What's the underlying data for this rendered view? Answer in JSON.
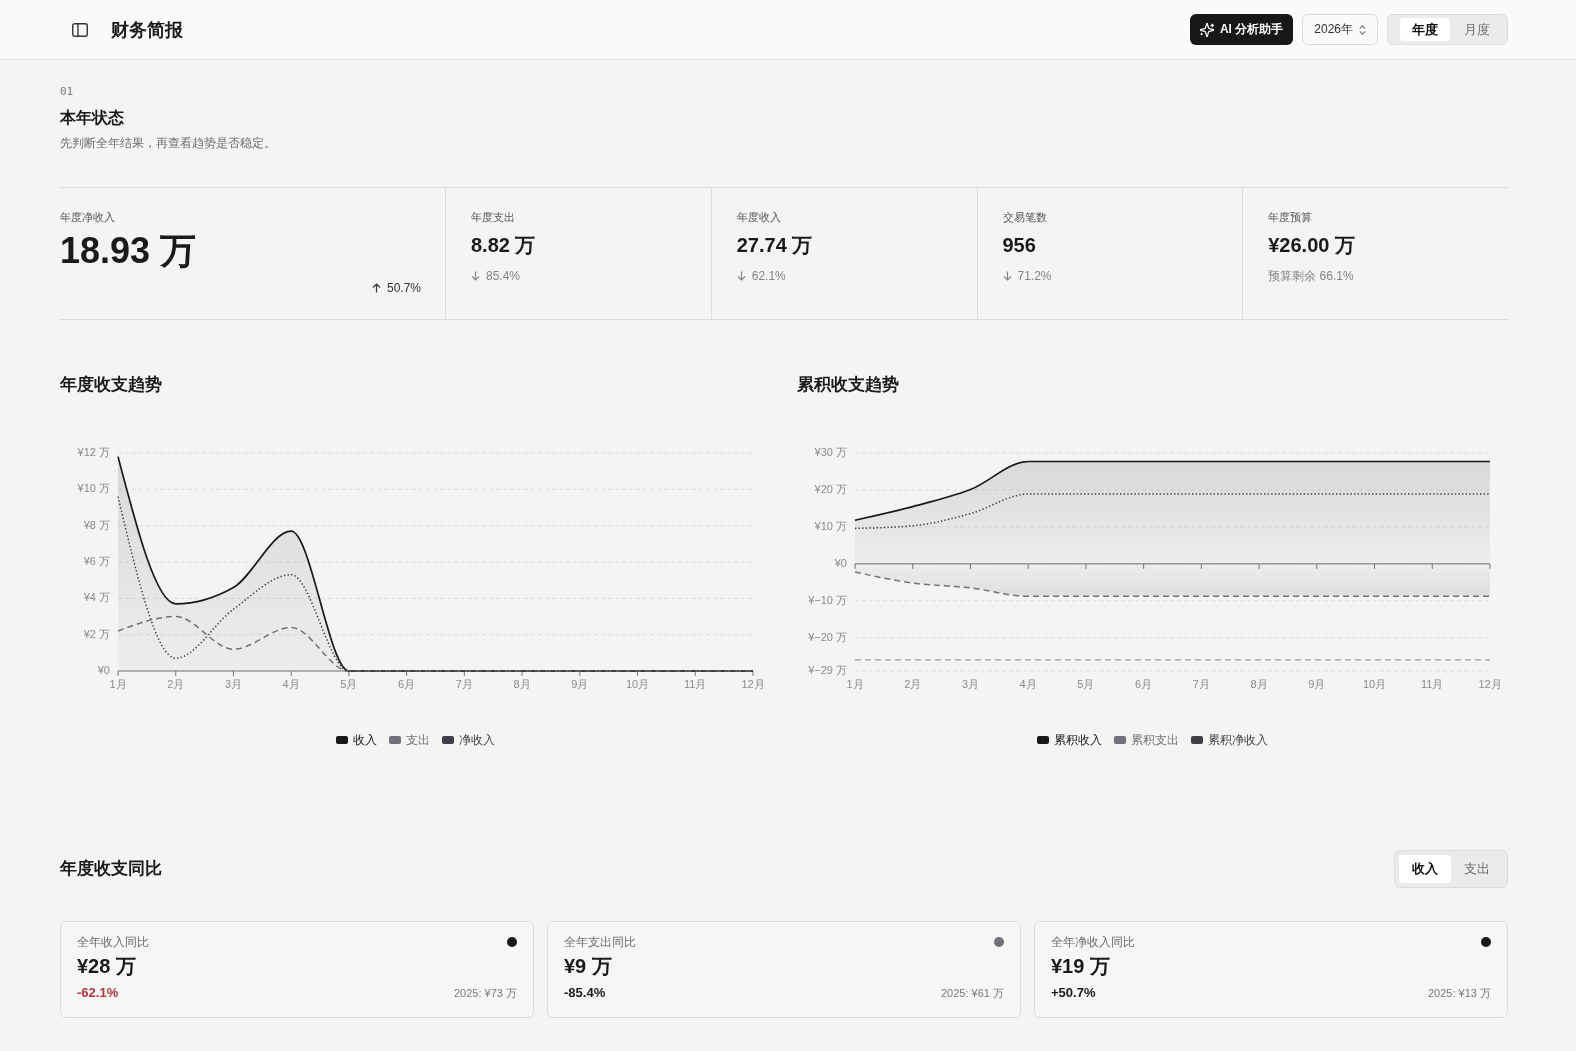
{
  "header": {
    "title": "财务简报",
    "ai_button": "AI 分析助手",
    "year_select": {
      "value": "2026年"
    },
    "period_tabs": [
      {
        "label": "年度",
        "selected": true
      },
      {
        "label": "月度",
        "selected": false
      }
    ]
  },
  "status": {
    "index": "01",
    "title": "本年状态",
    "description": "先判断全年结果，再查看趋势是否稳定。",
    "metrics": [
      {
        "kind": "hero",
        "label": "年度净收入",
        "value": "18.93 万",
        "rising": true,
        "change": "50.7%"
      },
      {
        "kind": "standard",
        "label": "年度支出",
        "value": "8.82 万",
        "rising": false,
        "change": "85.4%"
      },
      {
        "kind": "standard",
        "label": "年度收入",
        "value": "27.74 万",
        "rising": false,
        "change": "62.1%"
      },
      {
        "kind": "standard",
        "label": "交易笔数",
        "value": "956",
        "rising": false,
        "change": "71.2%"
      },
      {
        "kind": "standard",
        "label": "年度预算",
        "value": "¥26.00 万",
        "change": "预算剩余 66.1%"
      }
    ]
  },
  "charts": [
    {
      "title": "年度收支趋势",
      "chart_data": {
        "type": "area",
        "categories": [
          "1月",
          "2月",
          "3月",
          "4月",
          "5月",
          "6月",
          "7月",
          "8月",
          "9月",
          "10月",
          "11月",
          "12月"
        ],
        "series": [
          {
            "name": "收入",
            "color": "#18181b",
            "line_style": "solid",
            "values": [
              11.8,
              3.7,
              4.6,
              7.7,
              0,
              0,
              0,
              0,
              0,
              0,
              0,
              0
            ]
          },
          {
            "name": "支出",
            "type": "line",
            "color": "#71717a",
            "line_style": "dashed",
            "values": [
              2.2,
              3.0,
              1.2,
              2.4,
              0,
              0,
              0,
              0,
              0,
              0,
              0,
              0
            ]
          },
          {
            "name": "净收入",
            "type": "line",
            "color": "#3f3f46",
            "line_style": "dotted",
            "values": [
              9.6,
              0.7,
              3.4,
              5.3,
              0,
              0,
              0,
              0,
              0,
              0,
              0,
              0
            ]
          }
        ],
        "ylim": [
          0,
          12
        ],
        "yticks": [
          {
            "value": 0,
            "label": "¥0"
          },
          {
            "value": 2,
            "label": "¥2 万"
          },
          {
            "value": 4,
            "label": "¥4 万"
          },
          {
            "value": 6,
            "label": "¥6 万"
          },
          {
            "value": 8,
            "label": "¥8 万"
          },
          {
            "value": 10,
            "label": "¥10 万"
          },
          {
            "value": 12,
            "label": "¥12 万"
          }
        ],
        "grid": true
      }
    },
    {
      "title": "累积收支趋势",
      "chart_data": {
        "type": "area",
        "categories": [
          "1月",
          "2月",
          "3月",
          "4月",
          "5月",
          "6月",
          "7月",
          "8月",
          "9月",
          "10月",
          "11月",
          "12月"
        ],
        "series": [
          {
            "name": "累积收入",
            "color": "#18181b",
            "line_style": "solid",
            "values": [
              11.8,
              15.5,
              20.1,
              27.7,
              27.7,
              27.7,
              27.7,
              27.7,
              27.7,
              27.7,
              27.7,
              27.7
            ]
          },
          {
            "name": "累积支出",
            "color": "#71717a",
            "line_style": "dashed",
            "values": [
              -2.2,
              -5.2,
              -6.5,
              -8.8,
              -8.8,
              -8.8,
              -8.8,
              -8.8,
              -8.8,
              -8.8,
              -8.8,
              -8.8
            ]
          },
          {
            "name": "累积净收入",
            "type": "line",
            "color": "#3f3f46",
            "line_style": "dotted",
            "values": [
              9.6,
              10.3,
              13.6,
              18.9,
              18.9,
              18.9,
              18.9,
              18.9,
              18.9,
              18.9,
              18.9,
              18.9
            ]
          }
        ],
        "ylim": [
          -29,
          30
        ],
        "yticks": [
          {
            "value": 30,
            "label": "¥30 万"
          },
          {
            "value": 20,
            "label": "¥20 万"
          },
          {
            "value": 10,
            "label": "¥10 万"
          },
          {
            "value": 0,
            "label": "¥0"
          },
          {
            "value": -10,
            "label": "¥−10 万"
          },
          {
            "value": -20,
            "label": "¥−20 万"
          },
          {
            "value": -29,
            "label": "¥−29 万"
          }
        ],
        "grid": true,
        "ref_lines": [
          {
            "axis": "y",
            "value": -26
          }
        ]
      }
    }
  ],
  "comparison": {
    "title": "年度收支同比",
    "tabs": [
      {
        "label": "收入",
        "selected": true
      },
      {
        "label": "支出",
        "selected": false
      }
    ],
    "cards": [
      {
        "label": "全年收入同比",
        "color": "#18181b",
        "value": "¥28 万",
        "change": "-62.1%",
        "negative": true,
        "previous": "2025: ¥73 万"
      },
      {
        "label": "全年支出同比",
        "color": "#71717a",
        "value": "¥9 万",
        "change": "-85.4%",
        "negative": false,
        "previous": "2025: ¥61 万"
      },
      {
        "label": "全年净收入同比",
        "color": "#18181b",
        "value": "¥19 万",
        "change": "+50.7%",
        "negative": false,
        "previous": "2025: ¥13 万"
      }
    ]
  }
}
